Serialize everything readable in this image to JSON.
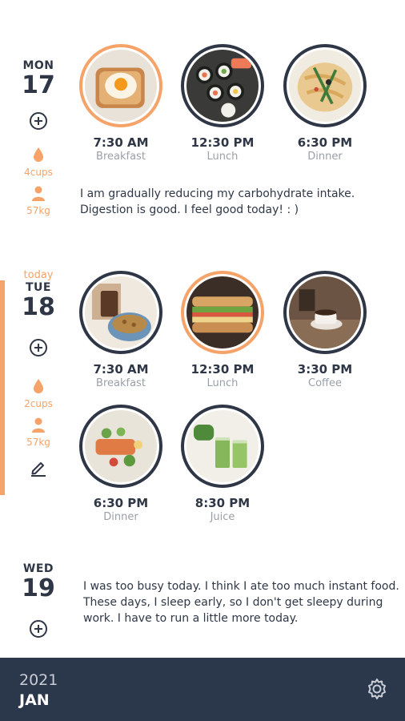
{
  "days": [
    {
      "dow": "MON",
      "num": "17",
      "water": "4cups",
      "weight": "57kg",
      "meals": [
        {
          "time": "7:30 AM",
          "label": "Breakfast",
          "photo": "egg-toast-photo"
        },
        {
          "time": "12:30 PM",
          "label": "Lunch",
          "photo": "sushi-photo"
        },
        {
          "time": "6:30 PM",
          "label": "Dinner",
          "photo": "pasta-photo"
        }
      ],
      "note": "I am gradually reducing my carbohydrate intake. Digestion is good. I feel good today! : )"
    },
    {
      "today_label": "today",
      "dow": "TUE",
      "num": "18",
      "water": "2cups",
      "weight": "57kg",
      "meals": [
        {
          "time": "7:30 AM",
          "label": "Breakfast",
          "photo": "granola-photo"
        },
        {
          "time": "12:30 PM",
          "label": "Lunch",
          "photo": "sandwich-photo"
        },
        {
          "time": "3:30 PM",
          "label": "Coffee",
          "photo": "coffee-photo"
        },
        {
          "time": "6:30 PM",
          "label": "Dinner",
          "photo": "salmon-salad-photo"
        },
        {
          "time": "8:30 PM",
          "label": "Juice",
          "photo": "green-juice-photo"
        }
      ]
    },
    {
      "dow": "WED",
      "num": "19",
      "note": "I was too busy today. I think I ate too much instant food. These days, I sleep early, so I don't get sleepy during work. I have to run a little more today."
    }
  ],
  "footer": {
    "year": "2021",
    "month": "JAN"
  },
  "colors": {
    "accent": "#f5a368",
    "navy": "#2f3747",
    "footer_bg": "#2b374a",
    "muted": "#9aa0a8"
  },
  "icons": [
    "add-icon",
    "water-drop-icon",
    "person-icon",
    "edit-pencil-icon",
    "settings-gear-icon"
  ]
}
